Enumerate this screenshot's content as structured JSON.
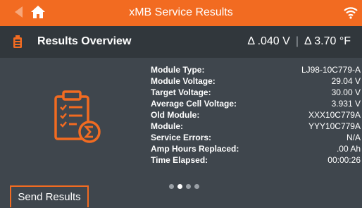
{
  "topbar": {
    "title": "xMB Service Results",
    "accent_color": "#f26b21",
    "icons": [
      "back-arrow-icon",
      "home-icon",
      "wifi-icon"
    ]
  },
  "header": {
    "title": "Results Overview",
    "icon": "module-icon",
    "delta_voltage": "Δ .040 V",
    "delta_temp": "Δ 3.70 °F"
  },
  "main": {
    "icon": "clipboard-summary-icon",
    "details": [
      {
        "label": "Module Type:",
        "value": "LJ98-10C779-A"
      },
      {
        "label": "Module Voltage:",
        "value": "29.04 V"
      },
      {
        "label": "Target Voltage:",
        "value": "30.00 V"
      },
      {
        "label": "Average Cell Voltage:",
        "value": "3.931 V"
      },
      {
        "label": "Old Module:",
        "value": "XXX10C779A"
      },
      {
        "label": "Module:",
        "value": "YYY10C779A"
      },
      {
        "label": "Service Errors:",
        "value": "N/A"
      },
      {
        "label": "Amp Hours Replaced:",
        "value": ".00 Ah"
      },
      {
        "label": "Time Elapsed:",
        "value": "00:00:26"
      }
    ],
    "page_dots": {
      "total": 4,
      "active_index": 1
    }
  },
  "footer": {
    "send_label": "Send Results"
  }
}
